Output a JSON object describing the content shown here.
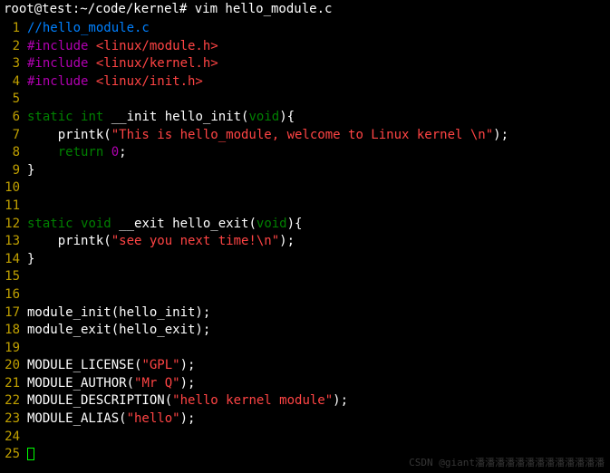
{
  "prompt": "root@test:~/code/kernel# vim hello_module.c",
  "watermark": "CSDN @giant潘潘潘潘潘潘潘潘潘潘潘潘潘",
  "lines": {
    "l1_comment": "//hello_module.c",
    "l2_pre": "#include ",
    "l2_inc": "<linux/module.h>",
    "l3_pre": "#include ",
    "l3_inc": "<linux/kernel.h>",
    "l4_pre": "#include ",
    "l4_inc": "<linux/init.h>",
    "l6_kw1": "static",
    "l6_kw2": "int",
    "l6_init": " __init hello_init(",
    "l6_void": "void",
    "l6_end": "){",
    "l7_indent": "    printk(",
    "l7_str": "\"This is hello_module, welcome to Linux kernel \\n\"",
    "l7_end": ");",
    "l8_indent": "    ",
    "l8_ret": "return",
    "l8_sp": " ",
    "l8_num": "0",
    "l8_end": ";",
    "l9": "}",
    "l12_kw1": "static",
    "l12_kw2": "void",
    "l12_exit": " __exit hello_exit(",
    "l12_void": "void",
    "l12_end": "){",
    "l13_indent": "    printk(",
    "l13_str": "\"see you next time!\\n\"",
    "l13_end": ");",
    "l14": "}",
    "l17": "module_init(hello_init);",
    "l18": "module_exit(hello_exit);",
    "l20_a": "MODULE_LICENSE(",
    "l20_s": "\"GPL\"",
    "l20_b": ");",
    "l21_a": "MODULE_AUTHOR(",
    "l21_s": "\"Mr Q\"",
    "l21_b": ");",
    "l22_a": "MODULE_DESCRIPTION(",
    "l22_s": "\"hello kernel module\"",
    "l22_b": ");",
    "l23_a": "MODULE_ALIAS(",
    "l23_s": "\"hello\"",
    "l23_b": ");"
  },
  "linenos": {
    "n1": "1",
    "n2": "2",
    "n3": "3",
    "n4": "4",
    "n5": "5",
    "n6": "6",
    "n7": "7",
    "n8": "8",
    "n9": "9",
    "n10": "10",
    "n11": "11",
    "n12": "12",
    "n13": "13",
    "n14": "14",
    "n15": "15",
    "n16": "16",
    "n17": "17",
    "n18": "18",
    "n19": "19",
    "n20": "20",
    "n21": "21",
    "n22": "22",
    "n23": "23",
    "n24": "24",
    "n25": "25"
  }
}
